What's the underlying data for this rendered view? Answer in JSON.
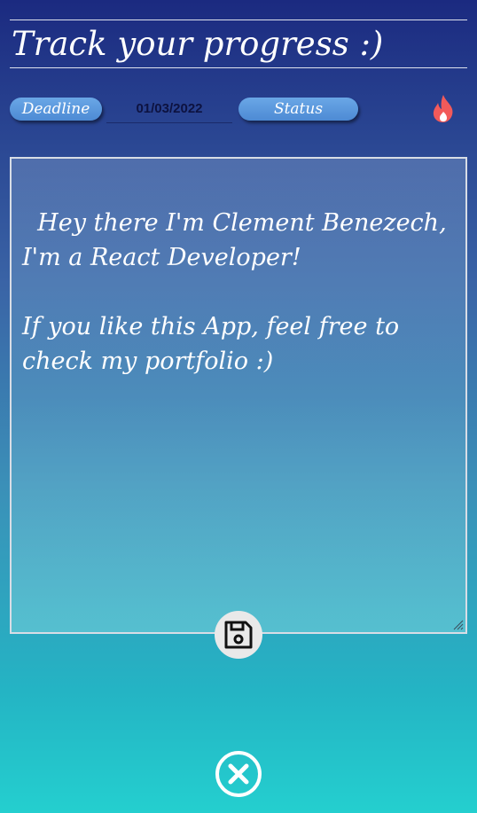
{
  "header": {
    "title": "Track your progress :)"
  },
  "toolbar": {
    "deadline_label": "Deadline",
    "deadline_value": "01/03/2022",
    "status_label": "Status",
    "status_icon": "fire-icon",
    "status_icon_color": "#f25a5a"
  },
  "note": {
    "text": "Hey there I'm Clement Benezech, I'm a React Developer!\n\nIf you like this App, feel free to check my portfolio :)"
  },
  "actions": {
    "save_icon": "floppy-disk-icon",
    "close_icon": "close-circle-icon"
  }
}
